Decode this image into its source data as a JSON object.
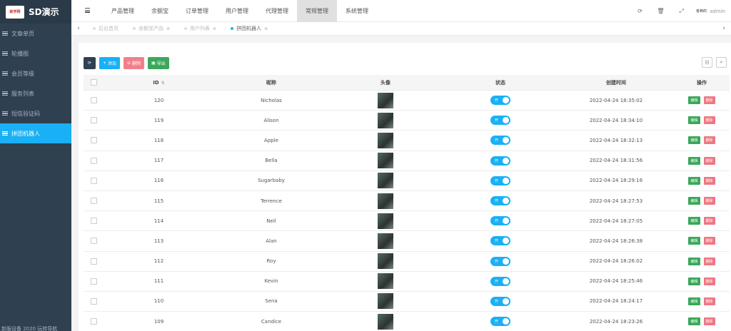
{
  "app": {
    "logo_text": "新学网",
    "title": "SD演示"
  },
  "sidebar": {
    "items": [
      {
        "label": "文章单页",
        "active": false
      },
      {
        "label": "轮播图",
        "active": false
      },
      {
        "label": "会员等级",
        "active": false
      },
      {
        "label": "服务列表",
        "active": false
      },
      {
        "label": "短信验证码",
        "active": false
      },
      {
        "label": "拼团机器人",
        "active": true
      }
    ],
    "footer": "新服设备 2020 玩转导航"
  },
  "topnav": {
    "tabs": [
      {
        "label": "产品管理",
        "active": false
      },
      {
        "label": "余额宝",
        "active": false
      },
      {
        "label": "订单管理",
        "active": false
      },
      {
        "label": "用户管理",
        "active": false
      },
      {
        "label": "代理管理",
        "active": false
      },
      {
        "label": "常规管理",
        "active": true
      },
      {
        "label": "系统管理",
        "active": false
      }
    ],
    "icons": [
      "refresh-icon",
      "trash-icon",
      "fullscreen-icon"
    ],
    "avatar_text": "各种的",
    "user_name": "admin"
  },
  "pagetabs": {
    "items": [
      {
        "label": "后台首页",
        "active": false,
        "closable": false
      },
      {
        "label": "余额宝产品",
        "active": false,
        "closable": true
      },
      {
        "label": "用户列表",
        "active": false,
        "closable": true
      },
      {
        "label": "拼团机器人",
        "active": true,
        "closable": true
      }
    ]
  },
  "toolbar": {
    "add_label": "添加",
    "delete_label": "删除",
    "export_label": "导出"
  },
  "table": {
    "headers": {
      "id": "ID",
      "nickname": "昵称",
      "avatar": "头像",
      "status": "状态",
      "created": "创建时间",
      "ops": "操作"
    },
    "toggle_text": "开",
    "edit_label": "编辑",
    "remove_label": "删除",
    "rows": [
      {
        "id": "120",
        "nickname": "Nicholas",
        "created": "2022-04-24 18:35:02"
      },
      {
        "id": "119",
        "nickname": "Alison",
        "created": "2022-04-24 18:34:10"
      },
      {
        "id": "118",
        "nickname": "Apple",
        "created": "2022-04-24 18:32:13"
      },
      {
        "id": "117",
        "nickname": "Bella",
        "created": "2022-04-24 18:31:56"
      },
      {
        "id": "116",
        "nickname": "Sugarbaby",
        "created": "2022-04-24 18:29:16"
      },
      {
        "id": "115",
        "nickname": "Terrence",
        "created": "2022-04-24 18:27:53"
      },
      {
        "id": "114",
        "nickname": "Neil",
        "created": "2022-04-24 18:27:05"
      },
      {
        "id": "113",
        "nickname": "Alan",
        "created": "2022-04-24 18:26:38"
      },
      {
        "id": "112",
        "nickname": "Roy",
        "created": "2022-04-24 18:26:02"
      },
      {
        "id": "111",
        "nickname": "Kevin",
        "created": "2022-04-24 18:25:46"
      },
      {
        "id": "110",
        "nickname": "Sena",
        "created": "2022-04-24 18:24:17"
      },
      {
        "id": "109",
        "nickname": "Candice",
        "created": "2022-04-24 18:23:26"
      }
    ]
  },
  "colors": {
    "sidebar": "#2f4050",
    "accent": "#1ab0f5",
    "success": "#3aa85a",
    "danger": "#ed5565"
  }
}
